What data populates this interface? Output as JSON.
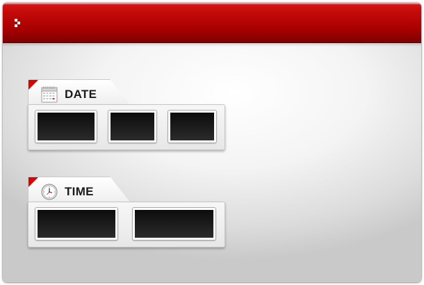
{
  "colors": {
    "titlebar": "#c40a0a",
    "accent": "#e00000",
    "field_bg": "#1a1a1a"
  },
  "window": {
    "app_icon": "app-logo-icon"
  },
  "date_section": {
    "label": "DATE",
    "icon": "calendar-icon",
    "fields": [
      {
        "name": "date-field-1",
        "value": ""
      },
      {
        "name": "date-field-2",
        "value": ""
      },
      {
        "name": "date-field-3",
        "value": ""
      }
    ]
  },
  "time_section": {
    "label": "TIME",
    "icon": "clock-icon",
    "fields": [
      {
        "name": "time-field-1",
        "value": ""
      },
      {
        "name": "time-field-2",
        "value": ""
      }
    ]
  }
}
